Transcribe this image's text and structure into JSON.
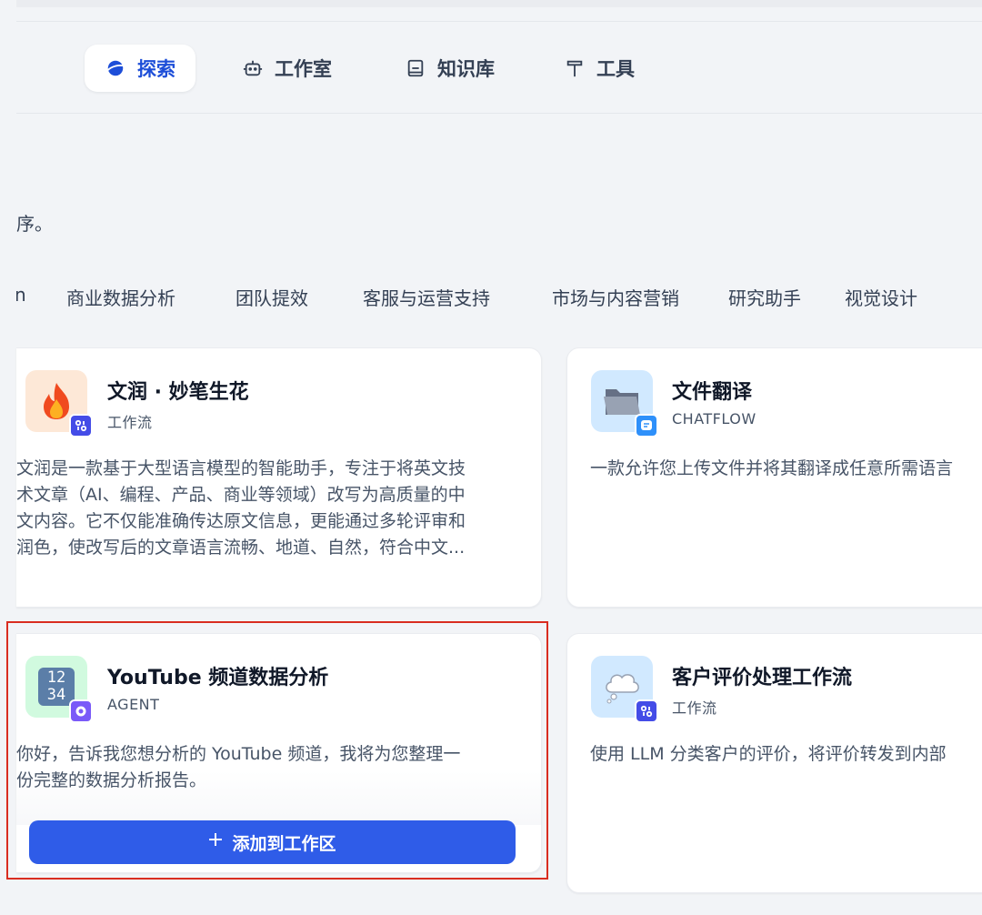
{
  "nav": {
    "items": [
      {
        "label": "探索",
        "icon": "planet-icon",
        "active": true
      },
      {
        "label": "工作室",
        "icon": "robot-icon",
        "active": false
      },
      {
        "label": "知识库",
        "icon": "book-icon",
        "active": false
      },
      {
        "label": "工具",
        "icon": "hammer-icon",
        "active": false
      }
    ]
  },
  "description_tail": "序。",
  "categories": [
    "n",
    "商业数据分析",
    "团队提效",
    "客服与运营支持",
    "市场与内容营销",
    "研究助手",
    "视觉设计"
  ],
  "cards": [
    {
      "title": "文润 · 妙笔生花",
      "type": "工作流",
      "description": [
        "文润是一款基于大型语言模型的智能助手，专注于将英文技",
        "术文章（AI、编程、产品、商业等领域）改写为高质量的中",
        "文内容。它不仅能准确传达原文信息，更能通过多轮评审和",
        "润色，使改写后的文章语言流畅、地道、自然，符合中文..."
      ],
      "icon": "fire-icon",
      "badge": "workflow-badge-icon"
    },
    {
      "title": "文件翻译",
      "type": "CHATFLOW",
      "description": [
        "一款允许您上传文件并将其翻译成任意所需语言"
      ],
      "icon": "folder-icon",
      "badge": "chatflow-badge-icon"
    },
    {
      "title": "YouTube 频道数据分析",
      "type": "AGENT",
      "description": [
        "你好，告诉我您想分析的 YouTube 频道，我将为您整理一",
        "份完整的数据分析报告。"
      ],
      "icon": "numbers-icon",
      "icon_text": [
        "12",
        "34"
      ],
      "badge": "agent-badge-icon",
      "button_label": "添加到工作区"
    },
    {
      "title": "客户评价处理工作流",
      "type": "工作流",
      "description": [
        "使用 LLM 分类客户的评价，将评价转发到内部"
      ],
      "icon": "thought-bubble-icon",
      "badge": "workflow-badge-icon"
    }
  ],
  "colors": {
    "accent": "#2f5ce8",
    "active_nav": "#1d4ed8",
    "highlight": "#d92d20",
    "workflow_badge": "#444ce7",
    "chatflow_badge": "#2e90fa",
    "agent_badge": "#7a5af8"
  }
}
